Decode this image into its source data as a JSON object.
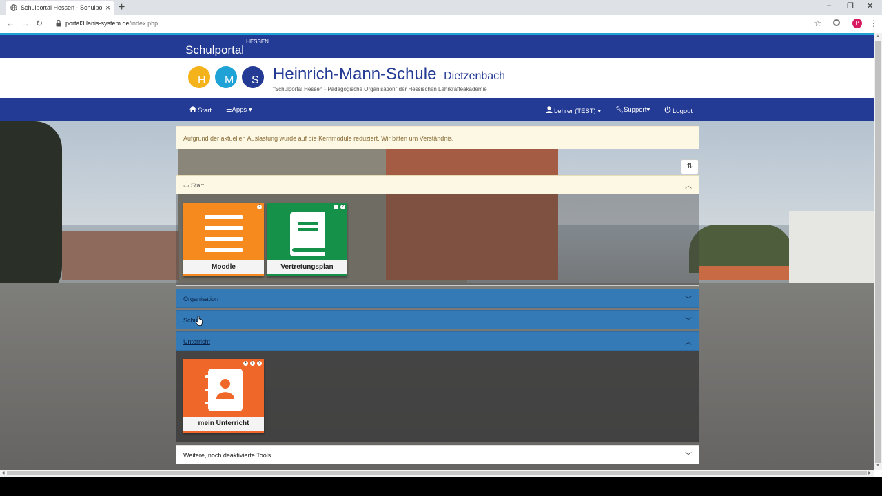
{
  "browser": {
    "tab_title": "Schulportal Hessen - Schulportal",
    "url_host": "portal3.lanis-system.de",
    "url_path": "/index.php",
    "profile_initial": "P"
  },
  "site": {
    "brand": "Schulportal",
    "brand_sup": "HESSEN",
    "logo_letters": [
      "H",
      "M",
      "S"
    ],
    "logo_colors": [
      "#f5b31b",
      "#1fa2d6",
      "#243b95"
    ],
    "school_name": "Heinrich-Mann-Schule",
    "school_location": "Dietzenbach",
    "school_subtitle": "\"Schulportal Hessen - Pädagogische Organisation\" der Hessischen Lehrkräfteakademie"
  },
  "nav": {
    "start": "Start",
    "apps": "Apps",
    "user": "Lehrer (TEST)",
    "support": "Support",
    "logout": "Logout"
  },
  "notice": "Aufgrund der aktuellen Auslastung wurde auf die Kernmodule reduziert. Wir bitten um Verständnis.",
  "panels": {
    "start": "Start",
    "organisation": "Organisation",
    "schule": "Schule",
    "unterricht": "Unterricht",
    "weitere": "Weitere, noch deaktivierte Tools"
  },
  "tiles": {
    "moodle": "Moodle",
    "vertretungsplan": "Vertretungsplan",
    "mein_unterricht": "mein Unterricht"
  },
  "colors": {
    "brand_blue": "#243b95",
    "panel_blue": "#337ab7",
    "moodle_orange": "#f68a1f",
    "vertretung_green": "#16914a",
    "unterricht_orange": "#f0672a"
  }
}
